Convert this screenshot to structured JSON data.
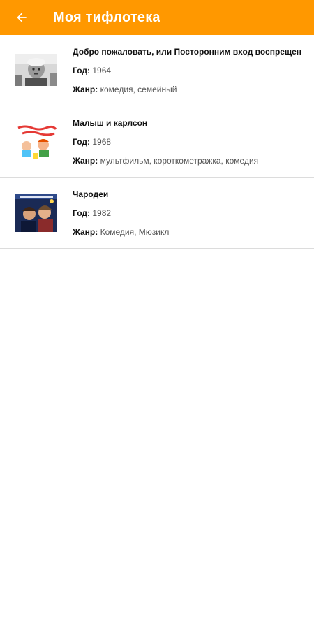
{
  "appbar": {
    "back_icon": "arrow-back-icon",
    "title": "Моя тифлотека",
    "color": "#ff9800"
  },
  "films": [
    {
      "title": "Добро пожаловать, или Посторонним вход воспрещен",
      "year_label": "Год:",
      "year": "1964",
      "genre_label": "Жанр:",
      "genre": "комедия, семейный"
    },
    {
      "title": "Малыш и карлсон",
      "year_label": "Год:",
      "year": "1968",
      "genre_label": "Жанр:",
      "genre": "мультфильм, короткометражка, комедия"
    },
    {
      "title": "Чародеи",
      "year_label": "Год:",
      "year": "1982",
      "genre_label": "Жанр:",
      "genre": "Комедия, Мюзикл"
    }
  ]
}
